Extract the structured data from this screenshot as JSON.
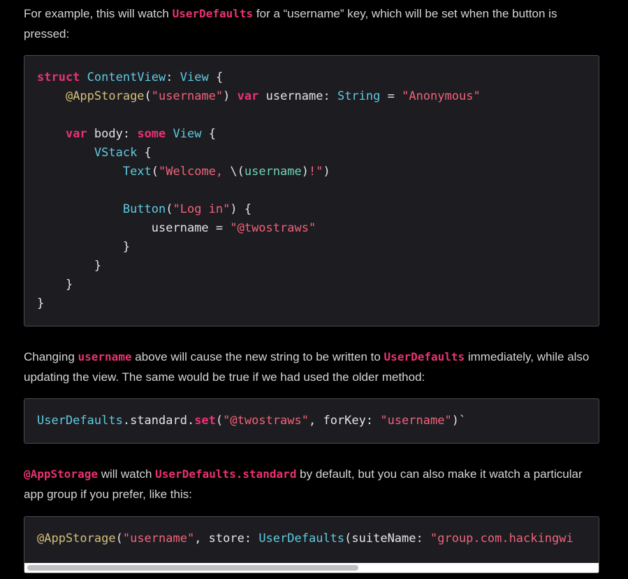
{
  "para1": {
    "pre": "For example, this will watch ",
    "code": "UserDefaults",
    "post": " for a “username” key, which will be set when the button is pressed:"
  },
  "code1": {
    "l1": {
      "kw": "struct",
      "ty1": "ContentView",
      "colon": ": ",
      "ty2": "View",
      "rest": " {"
    },
    "l2": {
      "indent": "    ",
      "at": "@AppStorage",
      "p1": "(",
      "st1": "\"username\"",
      "p2": ") ",
      "kw": "var",
      "p3": " username: ",
      "ty": "String",
      "p4": " = ",
      "st2": "\"Anonymous\""
    },
    "l4": {
      "indent": "    ",
      "kw1": "var",
      "p1": " body: ",
      "kw2": "some",
      "sp": " ",
      "ty": "View",
      "rest": " {"
    },
    "l5": {
      "indent": "        ",
      "ty": "VStack",
      "rest": " {"
    },
    "l6": {
      "indent": "            ",
      "ty": "Text",
      "p1": "(",
      "st1": "\"Welcome, ",
      "p2": "\\(",
      "in": "username",
      "p3": ")",
      "st2": "!\"",
      "p4": ")"
    },
    "l8": {
      "indent": "            ",
      "ty": "Button",
      "p1": "(",
      "st": "\"Log in\"",
      "p2": ") {"
    },
    "l9": {
      "indent": "                ",
      "p1": "username = ",
      "st": "\"@twostraws\""
    },
    "l10": "            }",
    "l11": "        }",
    "l12": "    }",
    "l13": "}"
  },
  "para2": {
    "pre": "Changing ",
    "code1": "username",
    "mid": " above will cause the new string to be written to ",
    "code2": "UserDefaults",
    "post": " immediately, while also updating the view. The same would be true if we had used the older method:"
  },
  "code2": {
    "ty": "UserDefaults",
    "p1": ".standard.",
    "kw": "set",
    "p2": "(",
    "st1": "\"@twostraws\"",
    "p3": ", forKey: ",
    "st2": "\"username\"",
    "p4": ")`"
  },
  "para3": {
    "code1": "@AppStorage",
    "mid": " will watch ",
    "code2": "UserDefaults.standard",
    "post": " by default, but you can also make it watch a particular app group if you prefer, like this:"
  },
  "code3": {
    "at": "@AppStorage",
    "p1": "(",
    "st1": "\"username\"",
    "p2": ", store: ",
    "ty": "UserDefaults",
    "p3": "(suiteName: ",
    "st2": "\"group.com.hackingwi"
  },
  "scrollbar": {
    "position": 0.58
  }
}
